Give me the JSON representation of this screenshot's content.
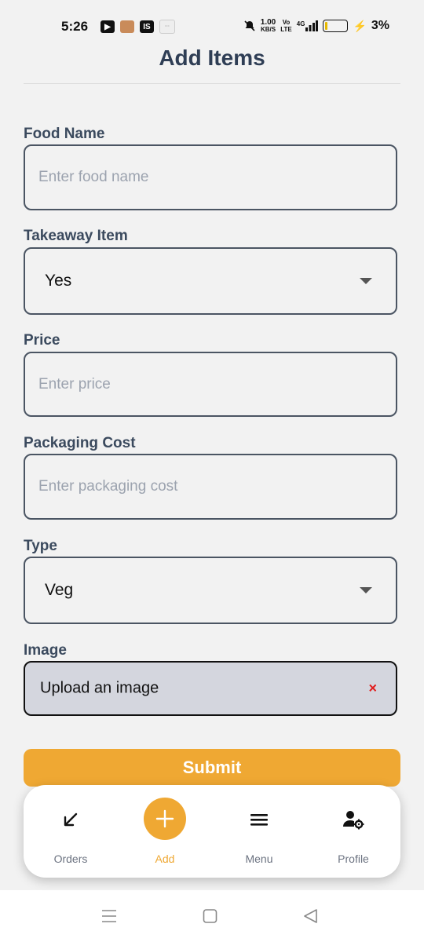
{
  "status_bar": {
    "time": "5:26",
    "app_badge": "IS",
    "net_speed_value": "1.00",
    "net_speed_unit": "KB/S",
    "volte_top": "Vo",
    "volte_bottom": "LTE",
    "network": "4G",
    "battery_percent": "3%"
  },
  "header": {
    "title": "Add Items"
  },
  "form": {
    "food_name": {
      "label": "Food Name",
      "placeholder": "Enter food name"
    },
    "takeaway": {
      "label": "Takeaway Item",
      "value": "Yes"
    },
    "price": {
      "label": "Price",
      "placeholder": "Enter price"
    },
    "packaging": {
      "label": "Packaging Cost",
      "placeholder": "Enter packaging cost"
    },
    "type": {
      "label": "Type",
      "value": "Veg"
    },
    "image": {
      "label": "Image",
      "value": "Upload an image",
      "remove": "×"
    },
    "submit_label": "Submit"
  },
  "bottom_nav": {
    "items": [
      {
        "label": "Orders",
        "icon": "arrow-down-left-icon"
      },
      {
        "label": "Add",
        "icon": "plus-icon",
        "active": true
      },
      {
        "label": "Menu",
        "icon": "hamburger-menu-icon"
      },
      {
        "label": "Profile",
        "icon": "user-settings-icon"
      }
    ]
  },
  "colors": {
    "accent": "#efa833",
    "label": "#3b4a5e",
    "title": "#2f3e55",
    "remove": "#e11d1d"
  }
}
